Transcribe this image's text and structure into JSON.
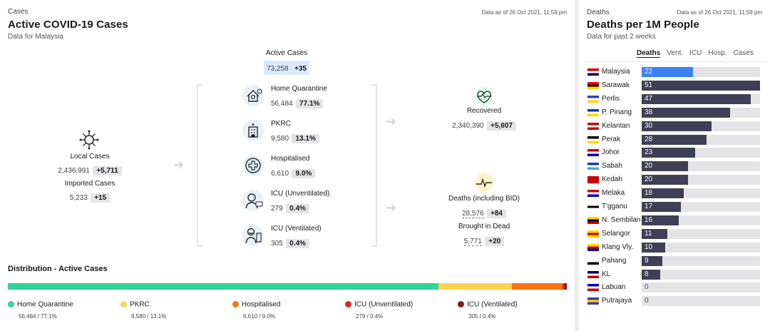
{
  "left": {
    "category": "Cases",
    "title": "Active COVID-19 Cases",
    "subtitle": "Data for Malaysia",
    "as_of": "Data as of 26 Oct 2021, 11:59 pm",
    "active": {
      "label": "Active Cases",
      "value": "73,258",
      "change": "+35"
    },
    "local": {
      "label": "Local Cases",
      "value": "2,436,991",
      "change": "+5,711"
    },
    "imported": {
      "label": "Imported Cases",
      "value": "5,233",
      "change": "+15"
    },
    "breakdown": [
      {
        "label": "Home Quarantine",
        "value": "56,484",
        "pct": "77.1%",
        "icon": "home-quarantine-icon"
      },
      {
        "label": "PKRC",
        "value": "9,580",
        "pct": "13.1%",
        "icon": "building-icon"
      },
      {
        "label": "Hospitalised",
        "value": "6,610",
        "pct": "9.0%",
        "icon": "medical-cross-icon"
      },
      {
        "label": "ICU (Unventilated)",
        "value": "279",
        "pct": "0.4%",
        "icon": "icu-patient-icon"
      },
      {
        "label": "ICU (Ventilated)",
        "value": "305",
        "pct": "0.4%",
        "icon": "ventilator-icon"
      }
    ],
    "recovered": {
      "label": "Recovered",
      "value": "2,340,390",
      "change": "+5,607"
    },
    "deaths": {
      "label": "Deaths (including BID)",
      "value": "28,576",
      "change": "+84"
    },
    "bid": {
      "label": "Brought in Dead",
      "value": "5,771",
      "change": "+20"
    },
    "distribution": {
      "title": "Distribution - Active Cases",
      "segments": [
        {
          "name": "Home Quarantine",
          "sub": "56,484 / 77.1%",
          "share": 77.1,
          "color": "#34d399"
        },
        {
          "name": "PKRC",
          "sub": "9,580 / 13.1%",
          "share": 13.1,
          "color": "#fcd34d"
        },
        {
          "name": "Hospitalised",
          "sub": "6,610 / 9.0%",
          "share": 9.0,
          "color": "#f97316"
        },
        {
          "name": "ICU (Unventilated)",
          "sub": "279 / 0.4%",
          "share": 0.4,
          "color": "#dc2626"
        },
        {
          "name": "ICU (Ventilated)",
          "sub": "305 / 0.4%",
          "share": 0.4,
          "color": "#7f1d1d"
        }
      ]
    }
  },
  "right": {
    "category": "Deaths",
    "title": "Deaths per 1M People",
    "subtitle": "Data for past 2 weeks",
    "as_of": "Data as of 26 Oct 2021, 11:59 pm",
    "tabs": [
      "Deaths",
      "Vent.",
      "ICU",
      "Hosp.",
      "Cases"
    ],
    "active_tab": 0
  },
  "chart_data": {
    "type": "bar",
    "orientation": "horizontal",
    "highlight": "Malaysia",
    "xlim": [
      0,
      51
    ],
    "categories": [
      "Malaysia",
      "Sarawak",
      "Perlis",
      "P. Pinang",
      "Kelantan",
      "Perak",
      "Johor",
      "Sabah",
      "Kedah",
      "Melaka",
      "T'gganu",
      "N. Sembilan",
      "Selangor",
      "Klang Vly.",
      "Pahang",
      "KL",
      "Labuan",
      "Putrajaya"
    ],
    "values": [
      22,
      51,
      47,
      38,
      30,
      28,
      23,
      20,
      20,
      18,
      17,
      16,
      11,
      10,
      9,
      8,
      0,
      0
    ],
    "colors": {
      "bar": "#3f3f56",
      "highlight": "#3b82f6",
      "track": "#e4e4e7"
    }
  }
}
